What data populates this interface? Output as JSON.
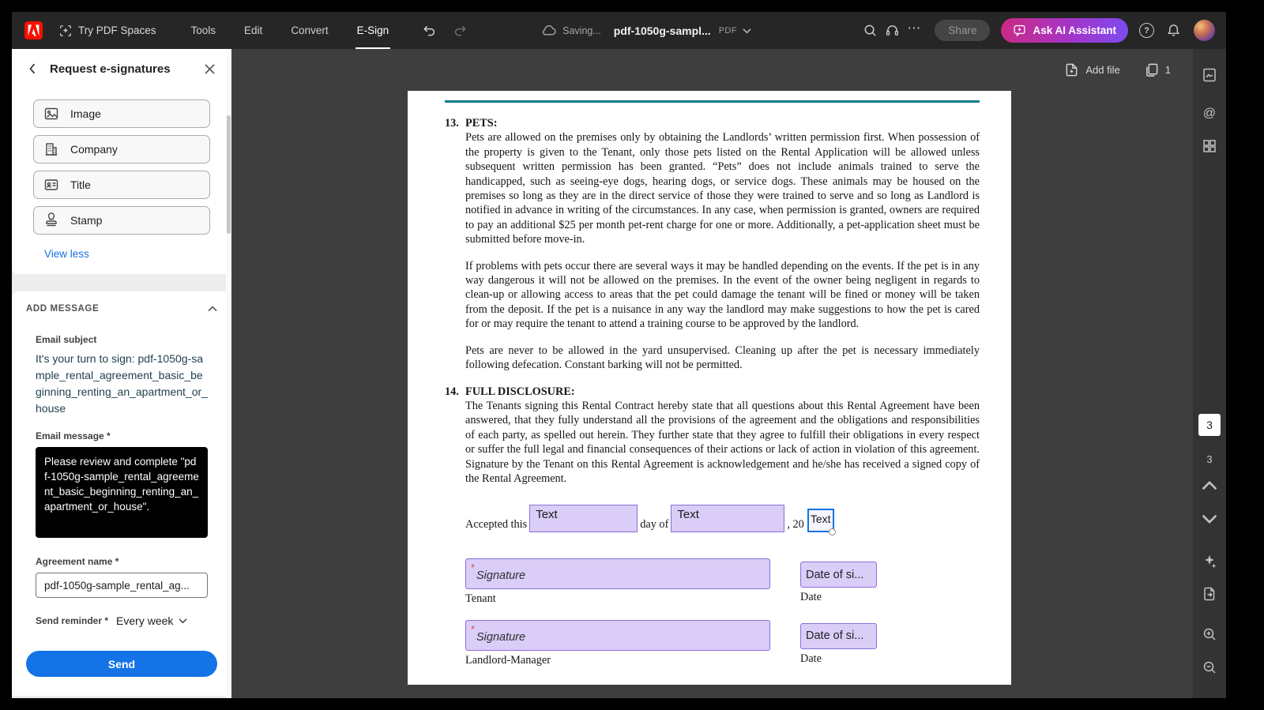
{
  "topbar": {
    "try_pdf_spaces": "Try PDF Spaces",
    "menu": [
      "Tools",
      "Edit",
      "Convert",
      "E-Sign"
    ],
    "saving": "Saving...",
    "filename": "pdf-1050g-sampl...",
    "file_format": "PDF",
    "share_label": "Share",
    "ask_ai_label": "Ask AI Assistant",
    "help_glyph": "?"
  },
  "doc_toolbar": {
    "add_file_label": "Add file",
    "page_count": "1"
  },
  "panel": {
    "title": "Request e-signatures",
    "field_buttons": [
      {
        "label": "Image"
      },
      {
        "label": "Company"
      },
      {
        "label": "Title"
      },
      {
        "label": "Stamp"
      }
    ],
    "view_less_label": "View less",
    "add_message_header": "ADD MESSAGE",
    "email_subject_label": "Email subject",
    "email_subject_value": "It's your turn to sign: pdf-1050g-sample_rental_agreement_basic_beginning_renting_an_apartment_or_house",
    "email_message_label": "Email message *",
    "email_message_value": "Please review and complete \"pdf-1050g-sample_rental_agreement_basic_beginning_renting_an_apartment_or_house\".",
    "agreement_name_label": "Agreement name *",
    "agreement_name_value": "pdf-1050g-sample_rental_ag...",
    "send_reminder_label": "Send reminder *",
    "send_reminder_value": "Every week",
    "send_label": "Send"
  },
  "document": {
    "section13_number": "13.",
    "section13_heading": "PETS:",
    "section13_p1": "Pets are allowed on the premises only by obtaining the Landlords’ written permission first. When possession of the property is given to the Tenant, only those pets listed on the Rental Application will be allowed unless subsequent written permission has been granted. “Pets” does not include animals trained to serve the handicapped, such as seeing-eye dogs, hearing dogs, or service dogs. These animals may be housed on the premises so long as they are in the direct service of those they were trained to serve and so long as Landlord is notified in advance in writing of the circumstances. In any case, when permission is granted, owners are required to pay an additional $25 per month pet-rent charge for one or more. Additionally, a pet-application sheet must be submitted before move-in.",
    "section13_p2": "If problems with pets occur there are several ways it may be handled depending on the events. If the pet is in any way dangerous it will not be allowed on the premises. In the event of the owner being negligent in regards to clean-up or allowing access to areas that the pet could damage the tenant will be fined or money will be taken from the deposit. If the pet is a nuisance in any way the landlord may make suggestions to how the pet is cared for or may require the tenant to attend a training course to be approved by the landlord.",
    "section13_p3": "Pets are never to be allowed in the yard unsupervised. Cleaning up after the pet is necessary immediately following defecation. Constant barking will not be permitted.",
    "section14_number": "14.",
    "section14_heading": "FULL DISCLOSURE:",
    "section14_p1": "The Tenants signing this Rental Contract hereby state that all questions about this Rental Agreement have been answered, that they fully understand all the provisions of the agreement and the obligations and responsibilities of each party, as spelled out herein. They further state that they agree to fulfill their obligations in every respect or suffer the full legal and financial consequences of their actions or lack of action in violation of this agreement. Signature by the Tenant on this Rental Agreement is acknowledgement and he/she has received a signed copy of the Rental Agreement.",
    "accepted_prefix": "Accepted this",
    "accepted_middle": "day of",
    "accepted_suffix": ", 20",
    "text_field_label": "Text",
    "signature_required_marker": "*",
    "signature_field_label": "Signature",
    "date_field_label": "Date of si...",
    "row1_caption": "Tenant",
    "row2_caption": "Landlord-Manager",
    "date_caption": "Date"
  },
  "right_rail": {
    "current_page": "3",
    "total_pages": "3"
  }
}
